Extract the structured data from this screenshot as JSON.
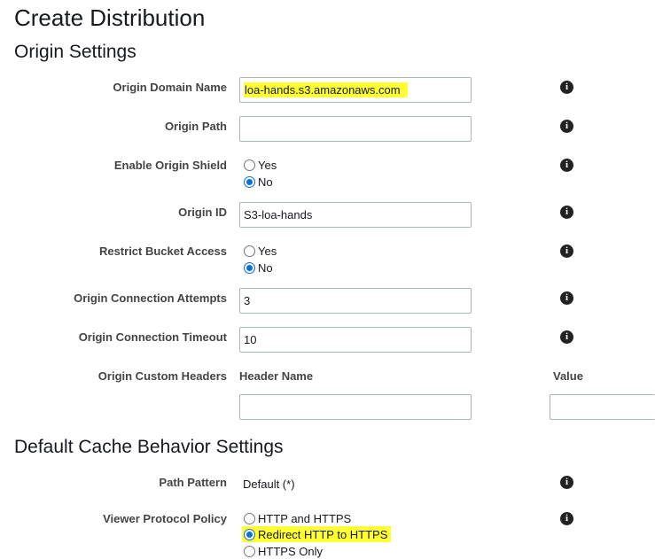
{
  "page": {
    "title": "Create Distribution",
    "origin_section_title": "Origin Settings",
    "cache_section_title": "Default Cache Behavior Settings"
  },
  "origin": {
    "domain_name": {
      "label": "Origin Domain Name",
      "value": "loa-hands.s3.amazonaws.com"
    },
    "path": {
      "label": "Origin Path",
      "value": ""
    },
    "shield": {
      "label": "Enable Origin Shield",
      "options": [
        "Yes",
        "No"
      ],
      "selected": "No"
    },
    "id": {
      "label": "Origin ID",
      "value": "S3-loa-hands"
    },
    "restrict_bucket": {
      "label": "Restrict Bucket Access",
      "options": [
        "Yes",
        "No"
      ],
      "selected": "No"
    },
    "connection_attempts": {
      "label": "Origin Connection Attempts",
      "value": "3"
    },
    "connection_timeout": {
      "label": "Origin Connection Timeout",
      "value": "10"
    },
    "custom_headers": {
      "label": "Origin Custom Headers",
      "header_name_col": "Header Name",
      "value_col": "Value",
      "header_name_value": "",
      "value_value": ""
    }
  },
  "cache": {
    "path_pattern": {
      "label": "Path Pattern",
      "value": "Default (*)"
    },
    "viewer_protocol": {
      "label": "Viewer Protocol Policy",
      "options": [
        "HTTP and HTTPS",
        "Redirect HTTP to HTTPS",
        "HTTPS Only"
      ],
      "selected": "Redirect HTTP to HTTPS"
    }
  },
  "icons": {
    "info": "info-icon"
  },
  "colors": {
    "highlight": "#ffff33",
    "radio_selected": "#0b6fd8",
    "input_border": "#aab7b8"
  }
}
